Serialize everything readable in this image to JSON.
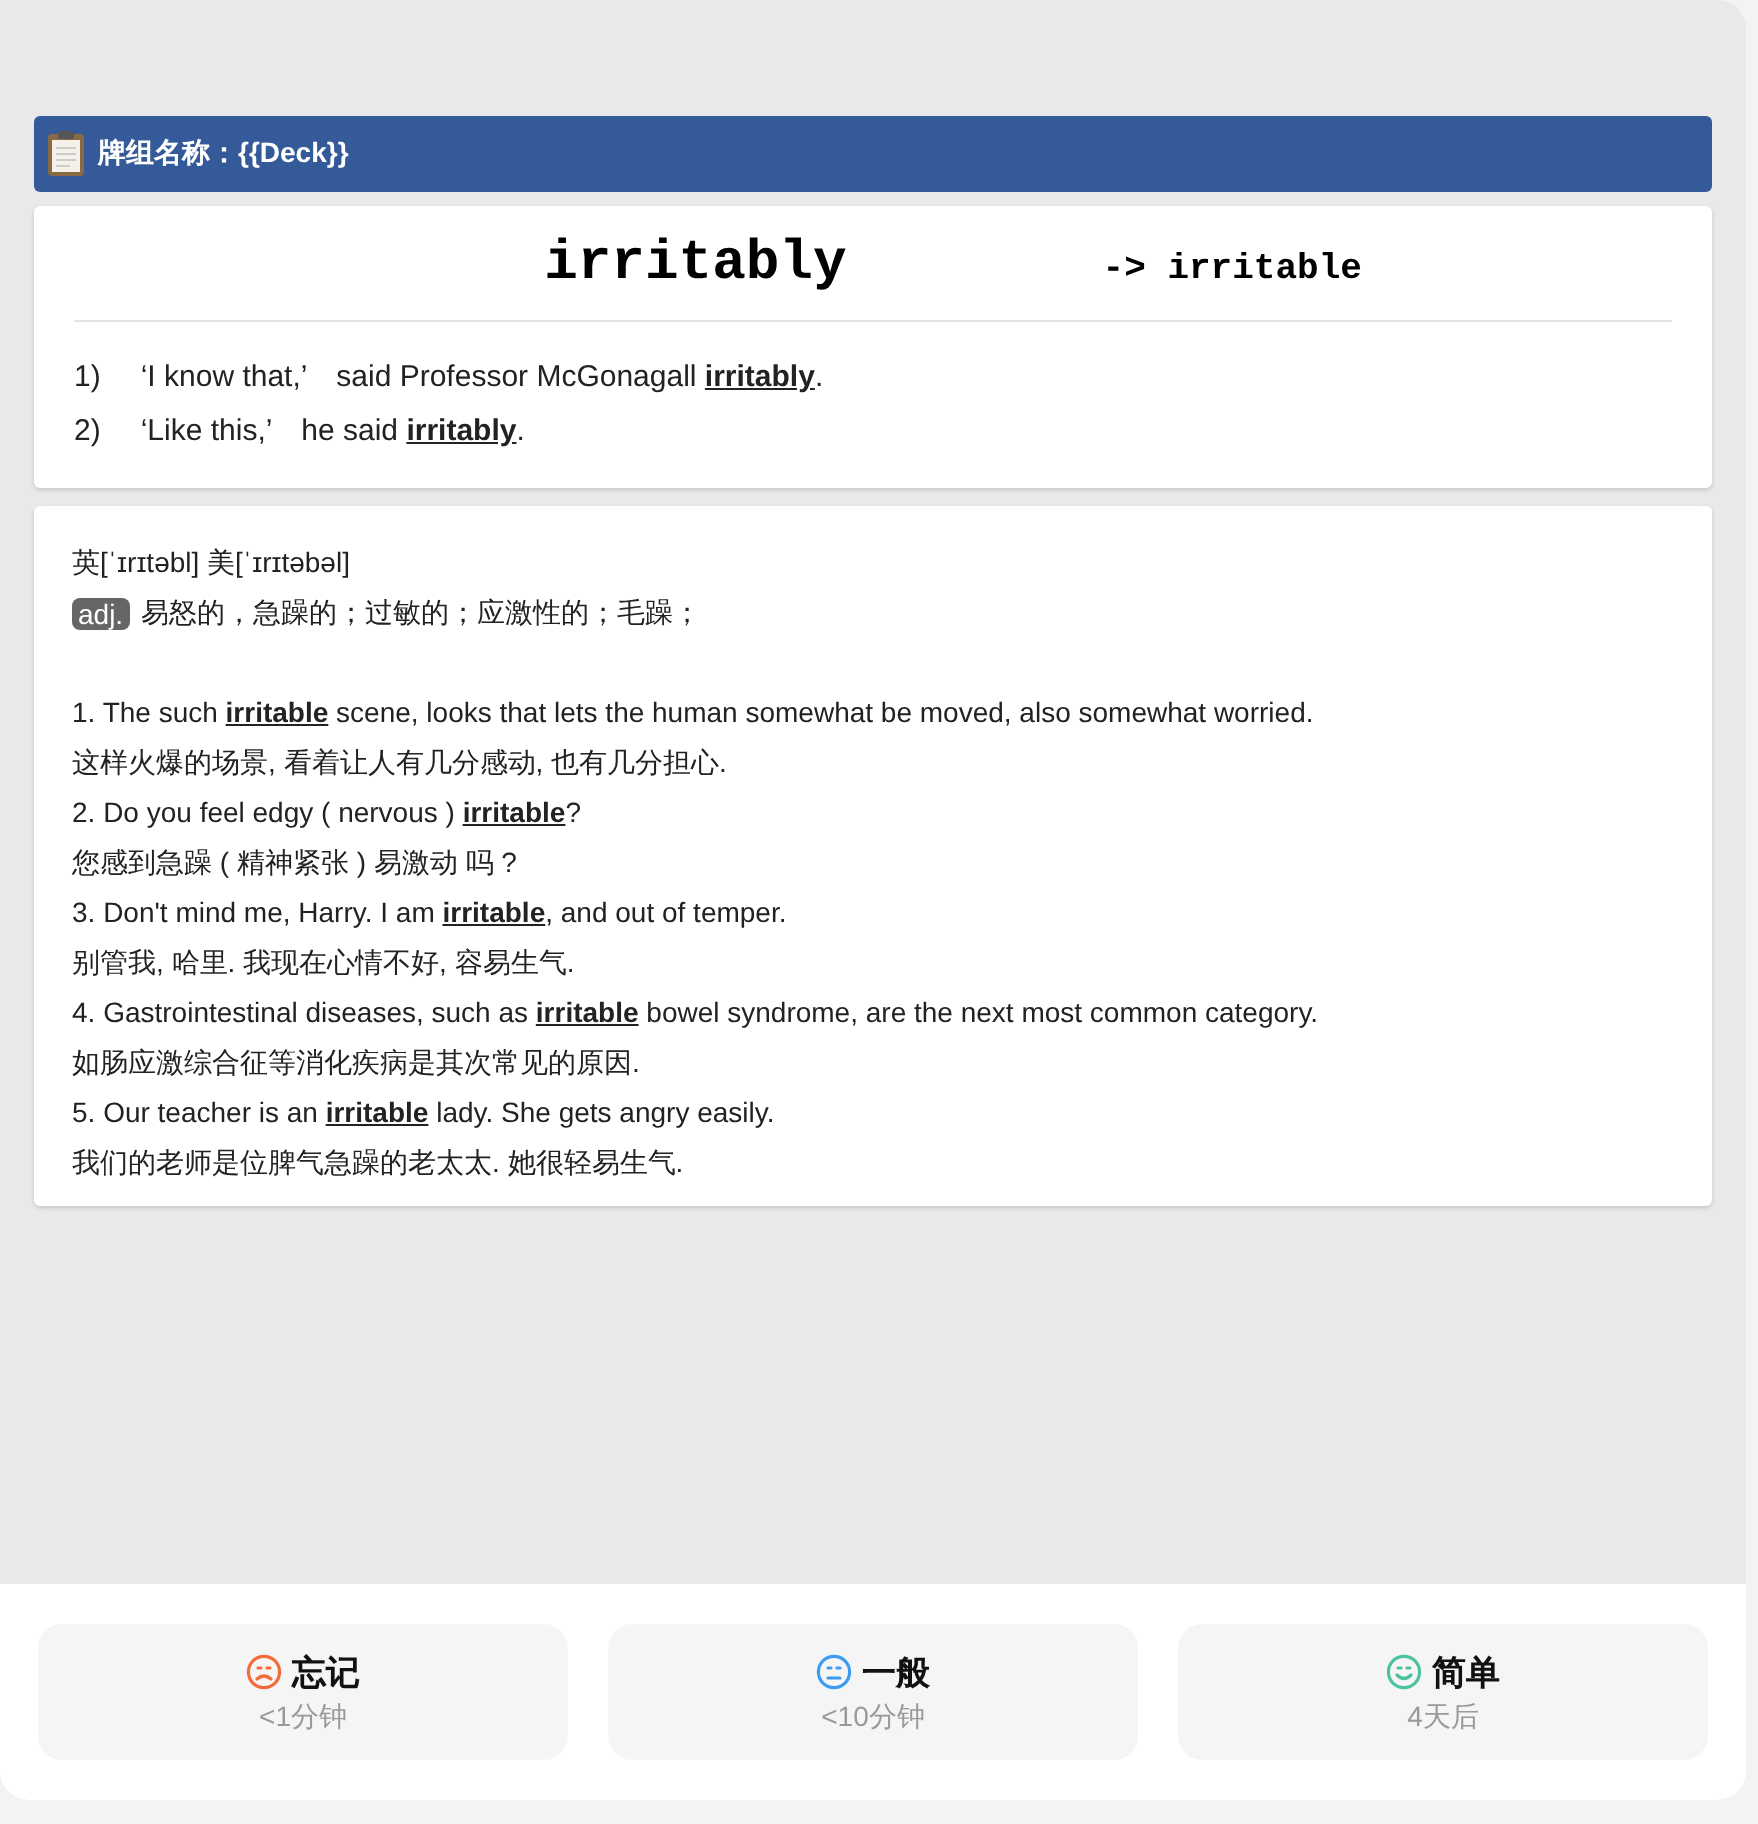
{
  "deck_header": {
    "title": "牌组名称：{{Deck}}"
  },
  "front": {
    "word": "irritably",
    "base_form": "-> irritable",
    "sentences": [
      {
        "number": "1)",
        "text": "‘I know that,’　said Professor McGonagall **irritably**."
      },
      {
        "number": "2)",
        "text": "‘Like this,’　he said **irritably**."
      }
    ]
  },
  "back": {
    "phonetic": "英[ˈɪrɪtəbl] 美[ˈɪrɪtəbəl]",
    "pos": "adj.",
    "meaning": "易怒的，急躁的；过敏的；应激性的；毛躁；",
    "examples": [
      "1. The such **irritable** scene, looks that lets the human somewhat be moved, also somewhat worried.",
      "这样火爆的场景, 看着让人有几分感动, 也有几分担心.",
      "2. Do you feel edgy ( nervous ) **irritable**?",
      "您感到急躁 ( 精神紧张 ) 易激动 吗 ?",
      "3. Don't mind me, Harry. I am **irritable**, and out of temper.",
      "别管我, 哈里. 我现在心情不好, 容易生气.",
      "4. Gastrointestinal diseases, such as **irritable** bowel syndrome, are the next most common category.",
      "如肠应激综合征等消化疾病是其次常见的原因.",
      "5. Our teacher is an **irritable** lady. She gets angry easily.",
      "我们的老师是位脾气急躁的老太太. 她很轻易生气."
    ]
  },
  "ease_buttons": [
    {
      "kind": "sad",
      "color": "#f26b3a",
      "label": "忘记",
      "interval": "<1分钟"
    },
    {
      "kind": "neutral",
      "color": "#3c9cf0",
      "label": "一般",
      "interval": "<10分钟"
    },
    {
      "kind": "happy",
      "color": "#4cc3a0",
      "label": "简单",
      "interval": "4天后"
    }
  ]
}
